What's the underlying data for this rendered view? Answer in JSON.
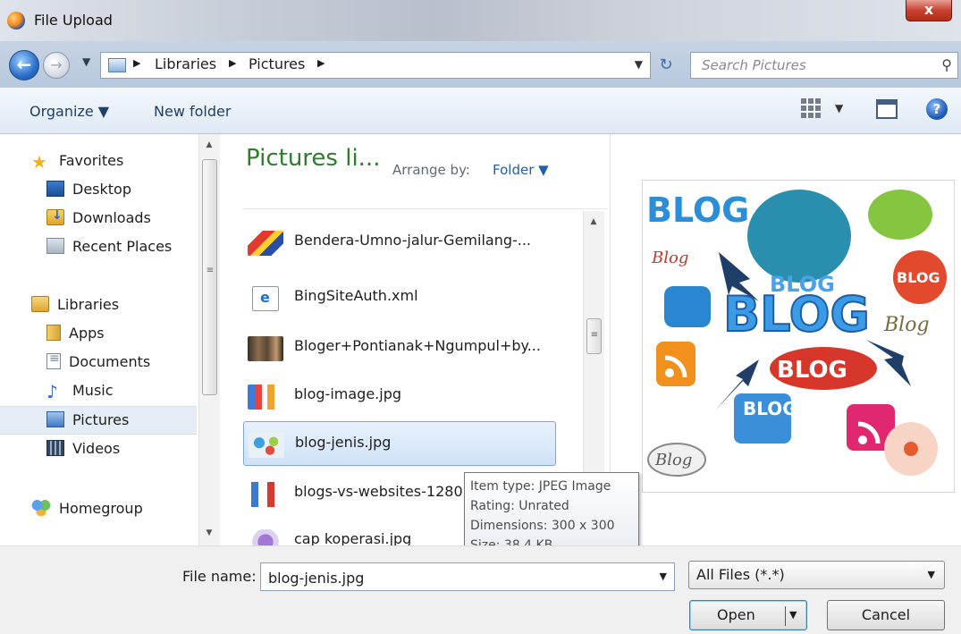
{
  "window": {
    "title": "File Upload",
    "close_label": "x"
  },
  "addressbar": {
    "breadcrumb": [
      "Libraries",
      "Pictures"
    ],
    "search_placeholder": "Search Pictures"
  },
  "toolbar": {
    "organize": "Organize ▼",
    "new_folder": "New folder"
  },
  "navigation": {
    "favorites": {
      "label": "Favorites",
      "items": [
        "Desktop",
        "Downloads",
        "Recent Places"
      ]
    },
    "libraries": {
      "label": "Libraries",
      "items": [
        "Apps",
        "Documents",
        "Music",
        "Pictures",
        "Videos"
      ]
    },
    "homegroup": "Homegroup",
    "selected": "Pictures"
  },
  "filelist": {
    "title": "Pictures li...",
    "arrange_label": "Arrange by:",
    "arrange_value": "Folder ▼",
    "items": [
      "Bendera-Umno-jalur-Gemilang-...",
      "BingSiteAuth.xml",
      "Bloger+Pontianak+Ngumpul+by...",
      "blog-image.jpg",
      "blog-jenis.jpg",
      "blogs-vs-websites-1280",
      "cap koperasi.jpg"
    ],
    "selected": "blog-jenis.jpg"
  },
  "tooltip": {
    "item_type": "Item type: JPEG Image",
    "rating": "Rating: Unrated",
    "dimensions": "Dimensions: 300 x 300",
    "size": "Size: 38,4 KB"
  },
  "preview": {
    "words": [
      "BLOG",
      "BLOG",
      "BLOG",
      "BLOG",
      "Blog",
      "BLOG",
      "Blog",
      "BLOG",
      "Blog"
    ]
  },
  "bottom": {
    "file_name_label": "File name:",
    "file_name_value": "blog-jenis.jpg",
    "file_type": "All Files (*.*)",
    "open": "Open",
    "cancel": "Cancel"
  }
}
